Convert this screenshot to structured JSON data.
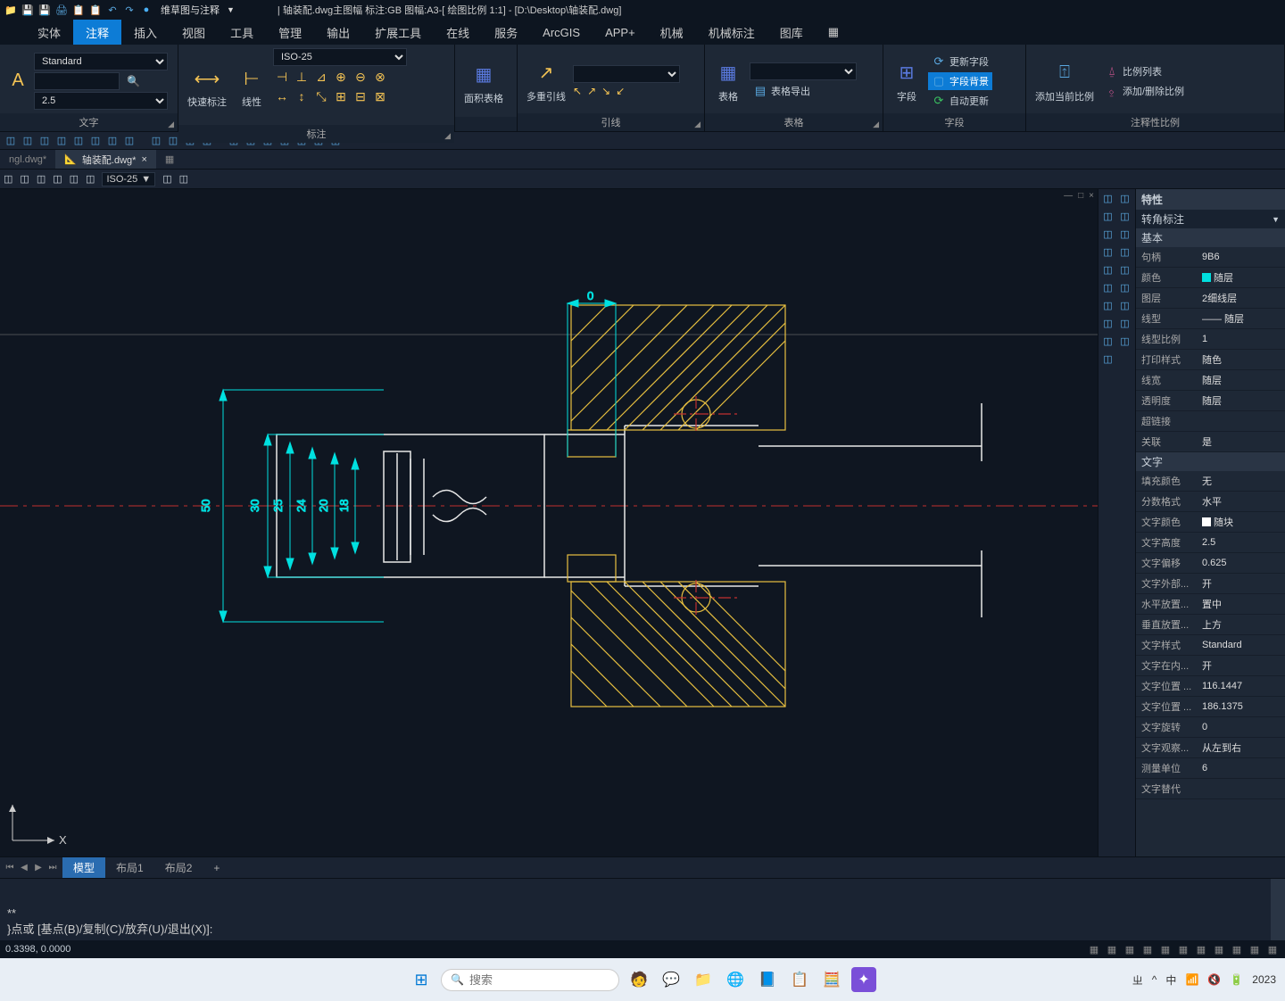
{
  "titlebar": {
    "workspace": "维草图与注释",
    "title": "| 轴装配.dwg主图幅  标注:GB 图幅:A3-[ 绘图比例 1:1] - [D:\\Desktop\\轴装配.dwg]"
  },
  "menu": {
    "tabs": [
      "",
      "实体",
      "注释",
      "插入",
      "视图",
      "工具",
      "管理",
      "输出",
      "扩展工具",
      "在线",
      "服务",
      "ArcGIS",
      "APP+",
      "机械",
      "机械标注",
      "图库"
    ],
    "active": 2
  },
  "ribbon": {
    "text_style": "Standard",
    "text_height": "2.5",
    "dim_style": "ISO-25",
    "panels": {
      "p1": "文字",
      "p2": "标注",
      "p3": "引线",
      "p4": "表格",
      "p5": "字段",
      "p6": "注释性比例"
    },
    "buttons": {
      "quick_dim": "快速标注",
      "linear": "线性",
      "area_table": "面积表格",
      "mleader": "多重引线",
      "table": "表格",
      "table_export": "表格导出",
      "field": "字段",
      "update_field": "更新字段",
      "field_bg": "字段背景",
      "auto_update": "自动更新",
      "add_scale": "添加当前比例",
      "scale_list": "比例列表",
      "add_del_scale": "添加/删除比例"
    }
  },
  "doctabs": {
    "tab1": "ngl.dwg*",
    "tab2": "轴装配.dwg*"
  },
  "layerbar": {
    "style": "ISO-25"
  },
  "props": {
    "title": "特性",
    "selection": "转角标注",
    "sections": {
      "basic": "基本",
      "text": "文字"
    },
    "rows": [
      {
        "k": "句柄",
        "v": "9B6"
      },
      {
        "k": "颜色",
        "v": "随层",
        "swatch": "#00e0e0"
      },
      {
        "k": "图层",
        "v": "2细线层"
      },
      {
        "k": "线型",
        "v": "—— 随层"
      },
      {
        "k": "线型比例",
        "v": "1"
      },
      {
        "k": "打印样式",
        "v": "随色"
      },
      {
        "k": "线宽",
        "v": "随层"
      },
      {
        "k": "透明度",
        "v": "随层"
      },
      {
        "k": "超链接",
        "v": ""
      },
      {
        "k": "关联",
        "v": "是"
      }
    ],
    "text_rows": [
      {
        "k": "填充颜色",
        "v": "无"
      },
      {
        "k": "分数格式",
        "v": "水平"
      },
      {
        "k": "文字颜色",
        "v": "随块",
        "swatch": "#ffffff"
      },
      {
        "k": "文字高度",
        "v": "2.5"
      },
      {
        "k": "文字偏移",
        "v": "0.625"
      },
      {
        "k": "文字外部...",
        "v": "开"
      },
      {
        "k": "水平放置...",
        "v": "置中"
      },
      {
        "k": "垂直放置...",
        "v": "上方"
      },
      {
        "k": "文字样式",
        "v": "Standard"
      },
      {
        "k": "文字在内...",
        "v": "开"
      },
      {
        "k": "文字位置 ...",
        "v": "116.1447"
      },
      {
        "k": "文字位置 ...",
        "v": "186.1375"
      },
      {
        "k": "文字旋转",
        "v": "0"
      },
      {
        "k": "文字观察...",
        "v": "从左到右"
      },
      {
        "k": "测量单位",
        "v": "6"
      },
      {
        "k": "文字替代",
        "v": ""
      }
    ]
  },
  "bottom": {
    "model": "模型",
    "layout1": "布局1",
    "layout2": "布局2"
  },
  "cmd": {
    "line1": "**",
    "line2": "}点或 [基点(B)/复制(C)/放弃(U)/退出(X)]:"
  },
  "status": {
    "coords": "0.3398, 0.0000"
  },
  "taskbar": {
    "search_ph": "搜索",
    "time": "2023"
  },
  "drawing": {
    "dims": {
      "d0": "0",
      "d18": "18",
      "d20": "20",
      "d24": "24",
      "d25": "25",
      "d30": "30",
      "d50": "50"
    }
  },
  "view_controls": {
    "min": "—",
    "max": "□",
    "close": "×"
  }
}
